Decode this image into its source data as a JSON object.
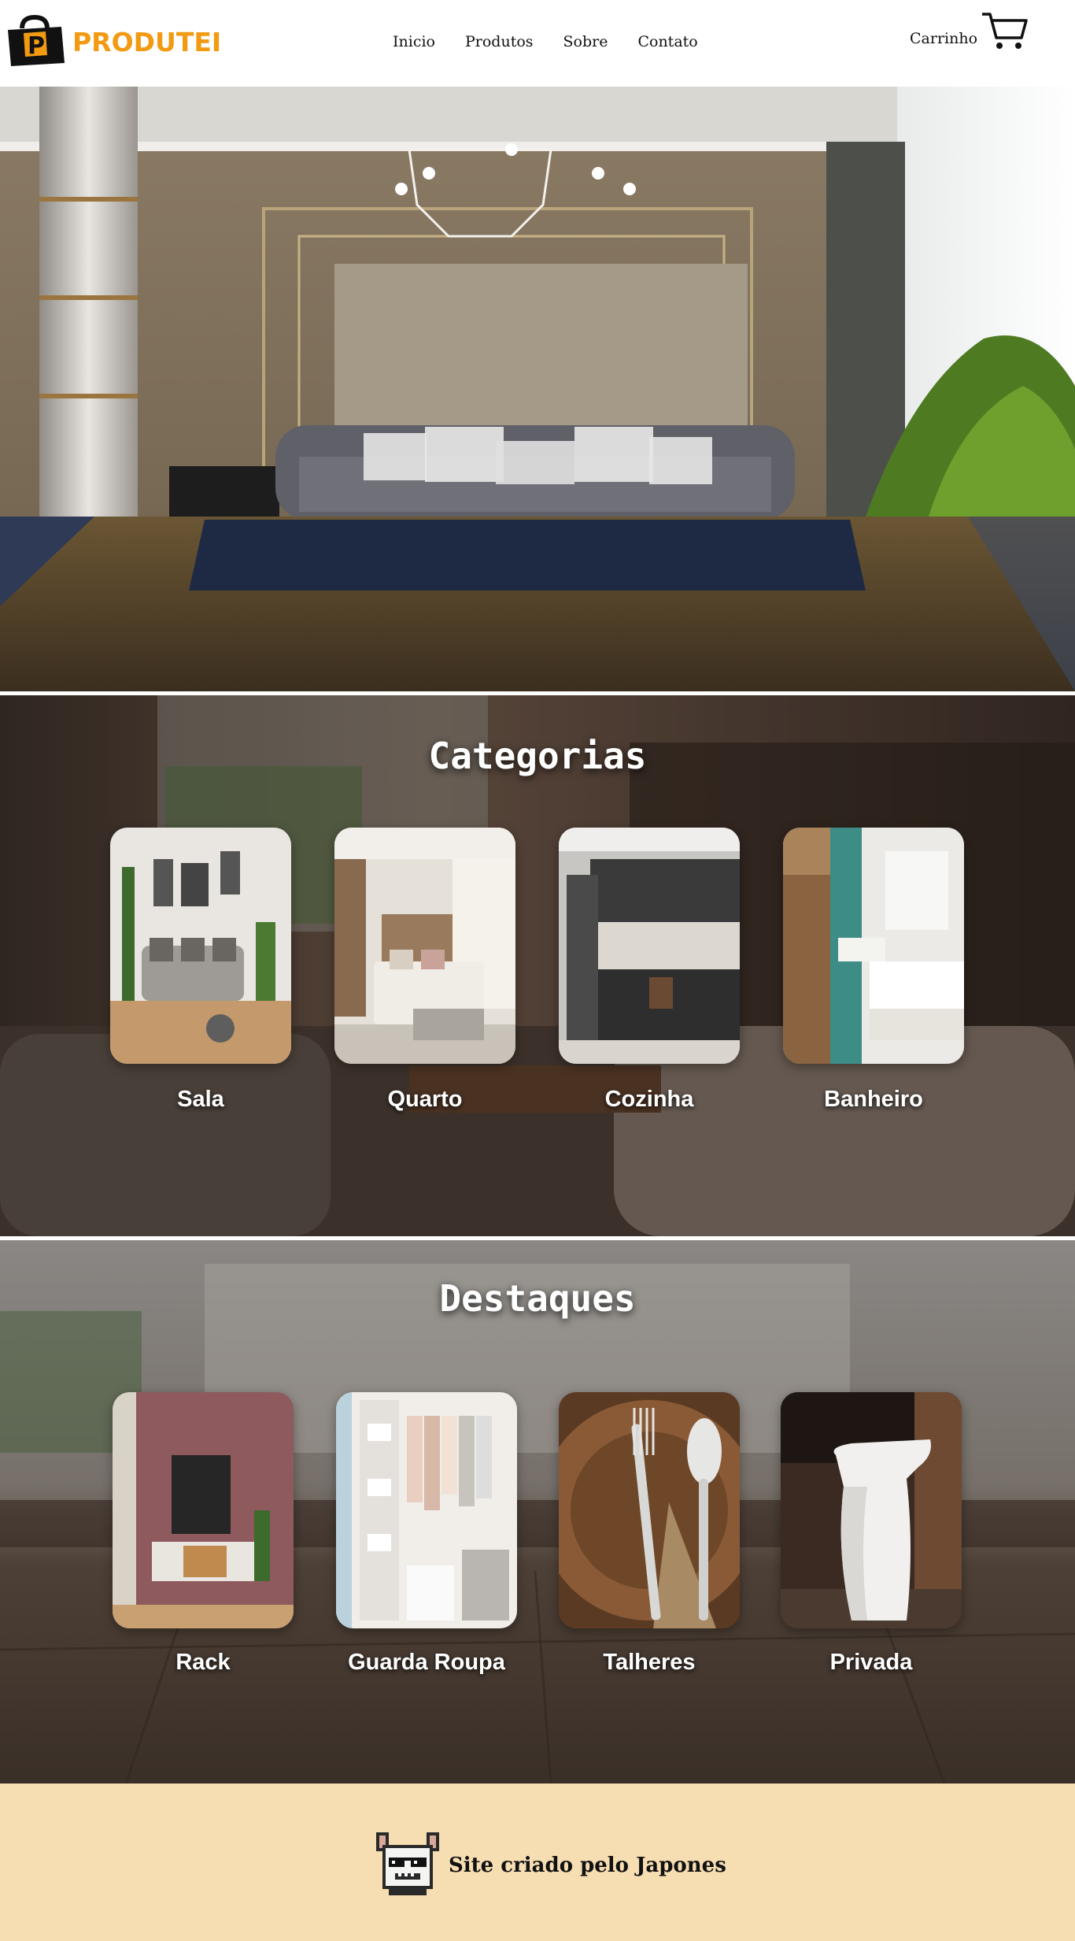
{
  "brand": {
    "name": "PRODUTEI",
    "logo_letter": "P",
    "accent": "#f29a12"
  },
  "nav": {
    "items": [
      {
        "label": "Inicio"
      },
      {
        "label": "Produtos"
      },
      {
        "label": "Sobre"
      },
      {
        "label": "Contato"
      }
    ]
  },
  "cart": {
    "label": "Carrinho",
    "icon": "cart-icon"
  },
  "categories": {
    "title": "Categorias",
    "items": [
      {
        "label": "Sala"
      },
      {
        "label": "Quarto"
      },
      {
        "label": "Cozinha"
      },
      {
        "label": "Banheiro"
      }
    ]
  },
  "highlights": {
    "title": "Destaques",
    "items": [
      {
        "label": "Rack"
      },
      {
        "label": "Guarda Roupa"
      },
      {
        "label": "Talheres"
      },
      {
        "label": "Privada"
      }
    ]
  },
  "footer": {
    "text": "Site criado pelo Japones",
    "background": "#f6ddb2"
  }
}
